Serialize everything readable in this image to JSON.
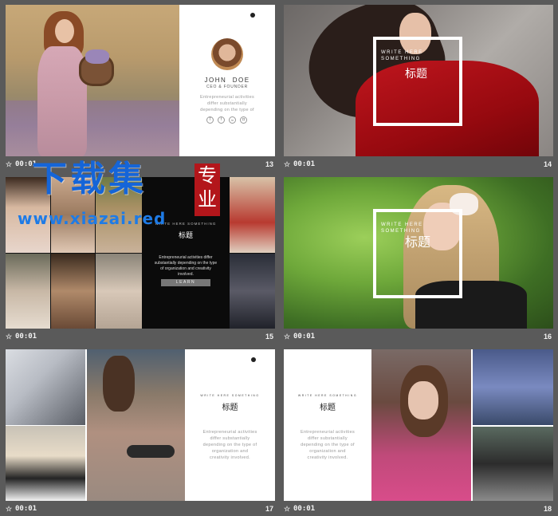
{
  "slides": [
    {
      "number": "13",
      "time": "00:01",
      "name": "JOHN  DOE",
      "role": "CEO & FOUNDER",
      "body": [
        "Entrepreneurial activities",
        "differ substantially",
        "depending on the type of"
      ],
      "social": [
        "T",
        "f",
        "in",
        "◘"
      ]
    },
    {
      "number": "14",
      "time": "00:01",
      "caps": [
        "WRITE HERE",
        "SOMETHING"
      ],
      "title": "标题"
    },
    {
      "number": "15",
      "time": "00:01",
      "caps": "WRITE HERE SOMETHING",
      "title": "标题",
      "body": [
        "Entrepreneurial activities differ",
        "substantially depending on the type",
        "of organization and creativity",
        "involved."
      ],
      "button": "LEARN"
    },
    {
      "number": "16",
      "time": "00:01",
      "caps": [
        "WRITE HERE",
        "SOMETHING"
      ],
      "title": "标题"
    },
    {
      "number": "17",
      "time": "00:01",
      "caps": "WRITE HERE SOMETHING",
      "title": "标题",
      "body": [
        "Entrepreneurial activities",
        "differ substantially",
        "depending on the type of",
        "organization and",
        "creativity involved."
      ]
    },
    {
      "number": "18",
      "time": "00:01",
      "caps": "WRITE HERE SOMETHING",
      "title": "标题",
      "body": [
        "Entrepreneurial activities",
        "differ substantially",
        "depending on the type of",
        "organization and",
        "creativity involved."
      ]
    }
  ],
  "watermark": {
    "main": "下载集",
    "url": "www.xiazai.red",
    "badge": [
      "专",
      "业"
    ]
  },
  "colors": {
    "background": "#5a5a5a",
    "selection": "#f5b34a",
    "watermark_blue": "#1565d8",
    "watermark_red": "#b3161b"
  }
}
